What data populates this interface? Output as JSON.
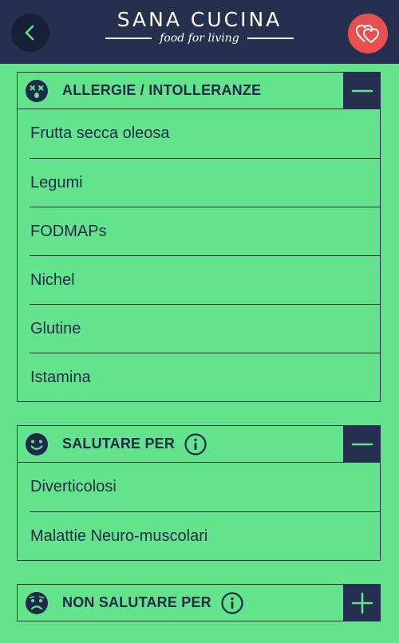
{
  "header": {
    "brand_name": "SANA CUCINA",
    "tagline": "food for living",
    "back_icon": "chevron-left-icon",
    "favorite_icon": "hearts-icon",
    "colors": {
      "bar": "#25304f",
      "back_button": "#162039",
      "favorite_button": "#e8504f"
    }
  },
  "sections": [
    {
      "title": "ALLERGIE / INTOLLERANZE",
      "icon": "dizzy-face-icon",
      "toggle": "minus-icon",
      "items": [
        "Frutta secca oleosa",
        "Legumi",
        "FODMAPs",
        "Nichel",
        "Glutine",
        "Istamina"
      ]
    },
    {
      "title": "SALUTARE PER",
      "icon": "smiling-face-icon",
      "info_icon": "info-icon",
      "toggle": "minus-icon",
      "items": [
        "Diverticolosi",
        "Malattie Neuro-muscolari"
      ]
    },
    {
      "title": "NON SALUTARE PER",
      "icon": "sad-face-icon",
      "info_icon": "info-icon",
      "toggle": "plus-icon",
      "items": []
    }
  ],
  "colors": {
    "background": "#62e48c",
    "text": "#1f2a4a"
  }
}
